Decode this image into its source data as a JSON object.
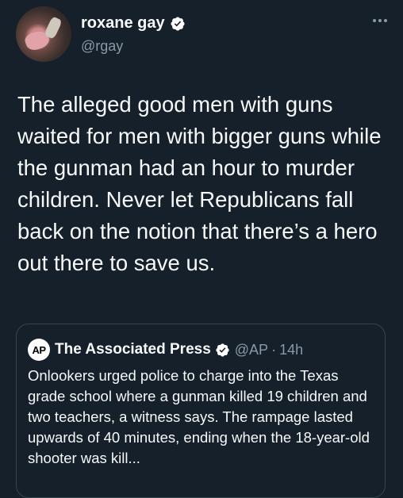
{
  "tweet": {
    "author": {
      "display_name": "roxane gay",
      "handle": "@rgay",
      "verified": true
    },
    "text": "The alleged good men with guns waited for men with bigger guns while the gunman had an hour to murder children. Never let Republicans fall back on the notion that there’s a hero out there to save us.",
    "more_icon": "more-horizontal-icon"
  },
  "quote": {
    "logo_text": "AP",
    "author_name": "The Associated Press",
    "verified": true,
    "handle": "@AP",
    "separator": "·",
    "time": "14h",
    "text": "Onlookers urged police to charge into the Texas grade school where a gunman killed 19 children and two teachers, a witness says. The rampage lasted upwards of 40 minutes, ending when the 18-year-old shooter was kill..."
  },
  "colors": {
    "background": "#15202b",
    "text": "#f7f9f9",
    "secondary": "#8b98a5",
    "border": "#38444d",
    "verified_badge": "#ffffff"
  }
}
